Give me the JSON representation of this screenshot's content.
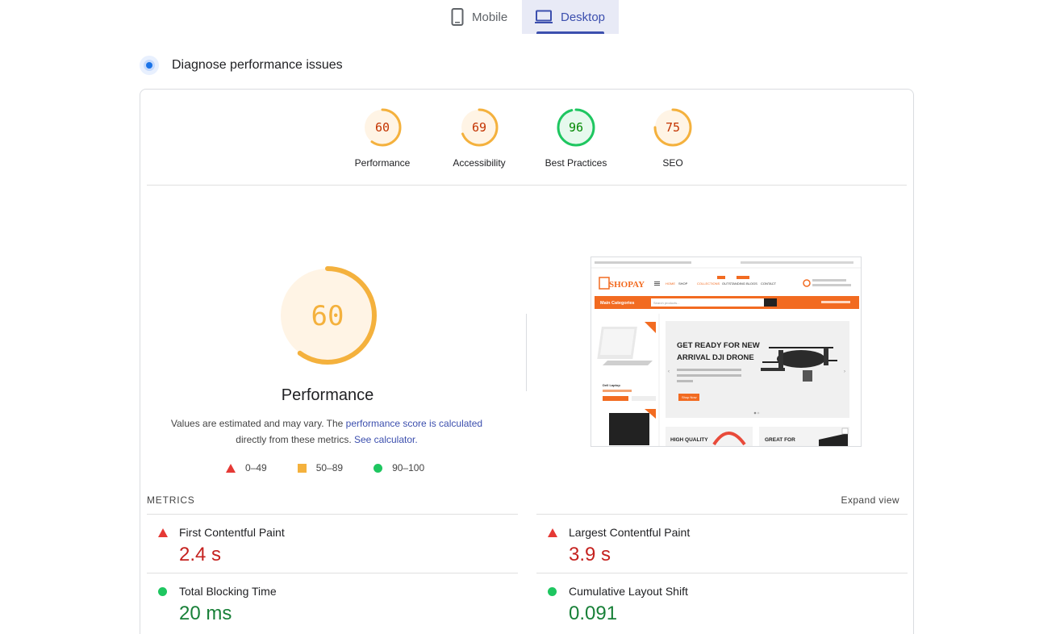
{
  "tabs": [
    {
      "label": "Mobile"
    },
    {
      "label": "Desktop"
    }
  ],
  "section": {
    "title": "Diagnose performance issues"
  },
  "scores": [
    {
      "value": "60",
      "label": "Performance",
      "score": 60,
      "color": "#f4b13d",
      "text_color": "#c33300",
      "fill": "#fff4e5"
    },
    {
      "value": "69",
      "label": "Accessibility",
      "score": 69,
      "color": "#f4b13d",
      "text_color": "#c33300",
      "fill": "#fff4e5"
    },
    {
      "value": "96",
      "label": "Best Practices",
      "score": 96,
      "color": "#1ec660",
      "text_color": "#008800",
      "fill": "#e6f9ed"
    },
    {
      "value": "75",
      "label": "SEO",
      "score": 75,
      "color": "#f4b13d",
      "text_color": "#c33300",
      "fill": "#fff4e5"
    }
  ],
  "main_score": {
    "value": "60",
    "label": "Performance",
    "score": 60
  },
  "description": {
    "text1": "Values are estimated and may vary. The ",
    "link1": "performance score is calculated",
    "text2": "directly from these metrics. ",
    "link2": "See calculator."
  },
  "legend": [
    {
      "range": "0–49",
      "shape": "triangle",
      "color": "#e53935"
    },
    {
      "range": "50–89",
      "shape": "square",
      "color": "#f4b13d"
    },
    {
      "range": "90–100",
      "shape": "circle",
      "color": "#1ec660"
    }
  ],
  "metrics": {
    "heading": "METRICS",
    "expand_label": "Expand view",
    "left": [
      {
        "name": "First Contentful Paint",
        "value": "2.4 s",
        "status": "bad"
      },
      {
        "name": "Total Blocking Time",
        "value": "20 ms",
        "status": "good"
      }
    ],
    "right": [
      {
        "name": "Largest Contentful Paint",
        "value": "3.9 s",
        "status": "bad"
      },
      {
        "name": "Cumulative Layout Shift",
        "value": "0.091",
        "status": "good"
      }
    ]
  },
  "screenshot": {
    "brand": "SHOPAY",
    "nav": [
      "HOME",
      "SHOP",
      "COLLECTIONS",
      "OUTSTANDING",
      "BLOGS",
      "CONTACT"
    ],
    "categories_label": "Main Categories",
    "search_placeholder": "Search products...",
    "banner_title_line1": "GET READY FOR NEW",
    "banner_title_line2": "ARRIVAL DJI DRONE",
    "banner_button": "Shop Now",
    "product_name": "Dell Laptop",
    "promo1": "HIGH QUALITY",
    "promo2": "GREAT FOR"
  }
}
